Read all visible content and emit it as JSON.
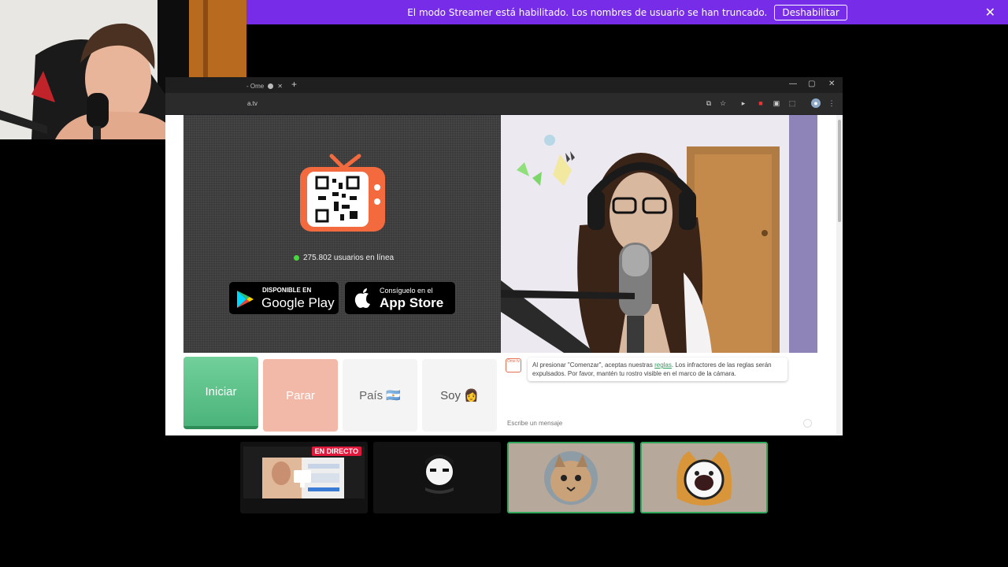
{
  "banner": {
    "message": "El modo Streamer está habilitado. Los nombres de usuario se han truncado.",
    "button_label": "Deshabilitar",
    "close_symbol": "✕",
    "color": "#772ce8"
  },
  "browser": {
    "tab_title": "- Ome",
    "tab_close": "✕",
    "new_tab": "+",
    "minimize": "—",
    "maximize": "▢",
    "close": "✕",
    "url": "a.tv",
    "toolbar_icons": [
      "install-icon",
      "star-icon",
      "play-icon",
      "record-icon",
      "extension-icon",
      "puzzle-icon",
      "profile-icon",
      "menu-icon"
    ]
  },
  "promo": {
    "online_text": "275.802 usuarios en línea",
    "google_small": "DISPONIBLE EN",
    "google_big": "Google Play",
    "apple_small": "Consíguelo en el",
    "apple_big": "App Store"
  },
  "controls": {
    "start": "Iniciar",
    "stop": "Parar",
    "country": "País 🇦🇷",
    "me": "Soy 👩"
  },
  "chat": {
    "avatar_text": "Ome tv",
    "message_prefix": "Al presionar \"Comenzar\", aceptas nuestras ",
    "message_link": "reglas",
    "message_suffix": ". Los infractores de las reglas serán expulsados. Por favor, mantén tu rostro visible en el marco de la cámara.",
    "input_placeholder": "Escribe un mensaje"
  },
  "tiles": {
    "live_badge": "EN DIRECTO"
  },
  "colors": {
    "start_green": "#4bb47a",
    "stop_salmon": "#f2b9a8",
    "tv_orange": "#f26a3d",
    "highlight_green": "#2fa85a"
  }
}
